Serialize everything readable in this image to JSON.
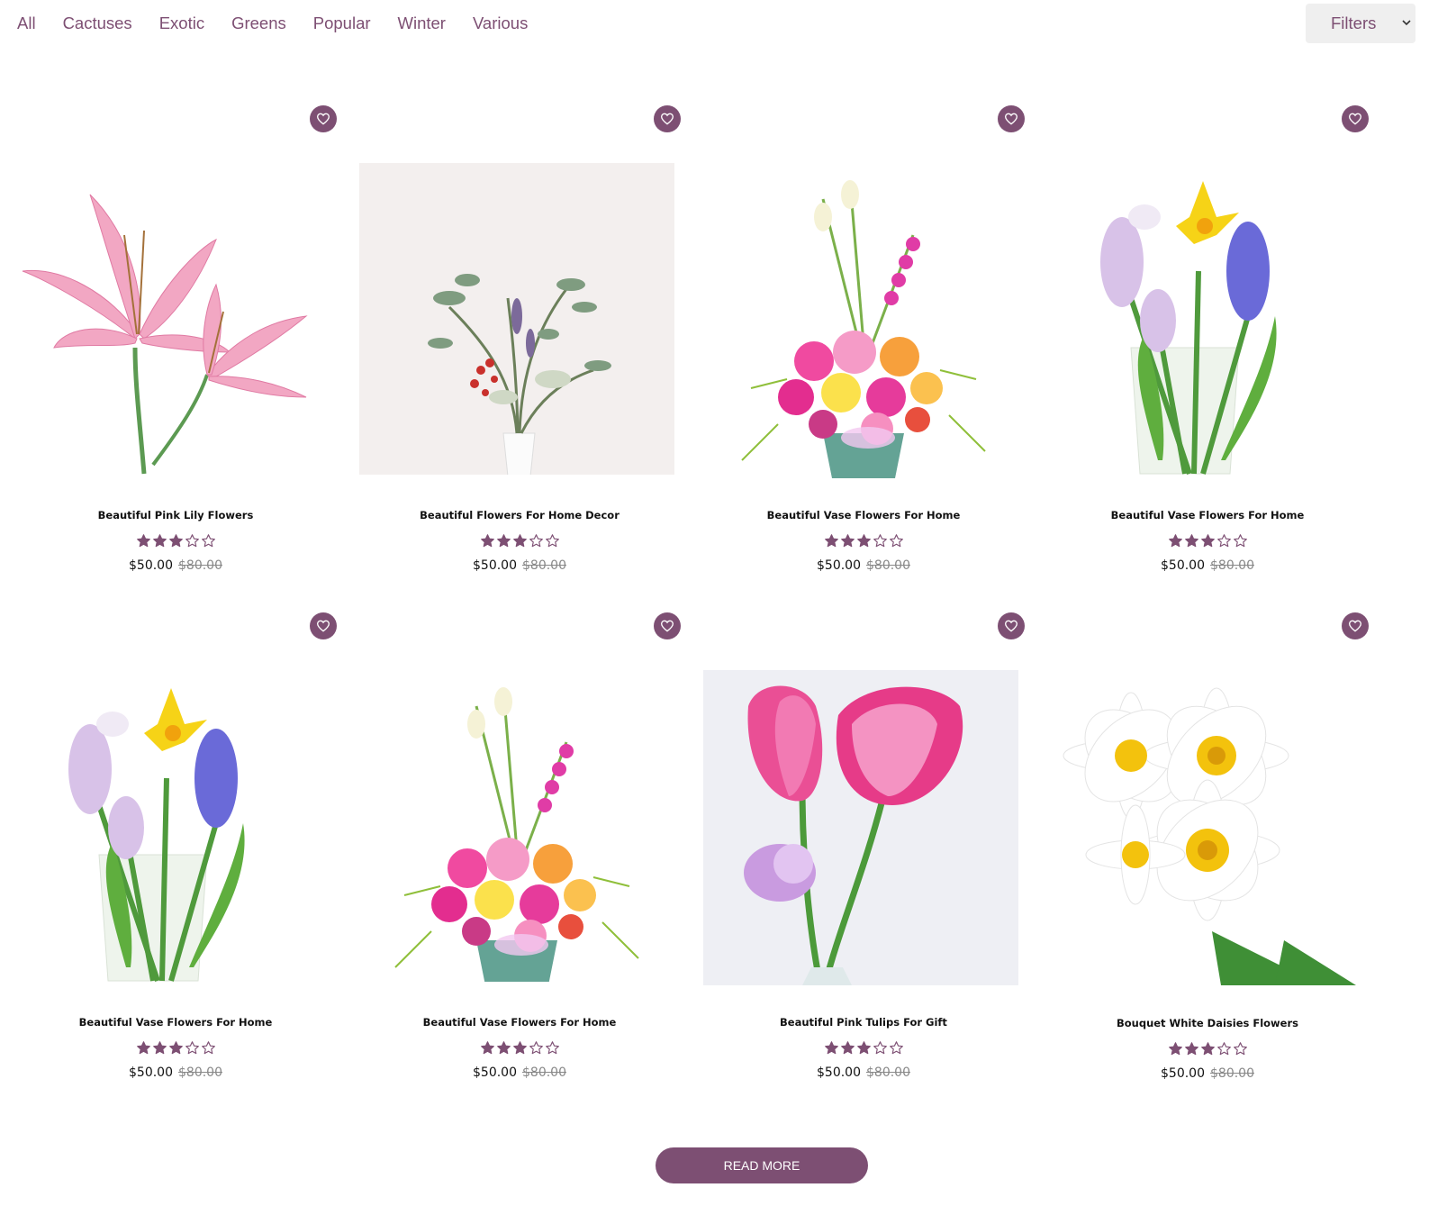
{
  "categories": [
    "All",
    "Cactuses",
    "Exotic",
    "Greens",
    "Popular",
    "Winter",
    "Various"
  ],
  "filters": {
    "label": "Filters"
  },
  "products": [
    {
      "title": "Beautiful Pink Lily Flowers",
      "rating": 3,
      "rating_max": 5,
      "price": "$50.00",
      "old_price": "$80.00",
      "image": "pink-lily"
    },
    {
      "title": "Beautiful Flowers For Home Decor",
      "rating": 3,
      "rating_max": 5,
      "price": "$50.00",
      "old_price": "$80.00",
      "image": "dried-bouquet"
    },
    {
      "title": "Beautiful Vase Flowers For Home",
      "rating": 3,
      "rating_max": 5,
      "price": "$50.00",
      "old_price": "$80.00",
      "image": "mixed-bouquet"
    },
    {
      "title": "Beautiful Vase Flowers For Home",
      "rating": 3,
      "rating_max": 5,
      "price": "$50.00",
      "old_price": "$80.00",
      "image": "hyacinth-vase"
    },
    {
      "title": "Beautiful Vase Flowers For Home",
      "rating": 3,
      "rating_max": 5,
      "price": "$50.00",
      "old_price": "$80.00",
      "image": "hyacinth-vase"
    },
    {
      "title": "Beautiful Vase Flowers For Home",
      "rating": 3,
      "rating_max": 5,
      "price": "$50.00",
      "old_price": "$80.00",
      "image": "mixed-bouquet"
    },
    {
      "title": "Beautiful Pink Tulips For Gift",
      "rating": 3,
      "rating_max": 5,
      "price": "$50.00",
      "old_price": "$80.00",
      "image": "pink-tulips"
    },
    {
      "title": "Bouquet White Daisies Flowers",
      "rating": 3,
      "rating_max": 5,
      "price": "$50.00",
      "old_price": "$80.00",
      "image": "white-daisies"
    }
  ],
  "read_more": "READ MORE",
  "colors": {
    "accent": "#7d4f73",
    "star": "#7d4f73",
    "old_price": "#888888"
  },
  "icons": {
    "wishlist": "heart-icon",
    "rating": "star-icon",
    "filter_dropdown": "chevron-down-icon"
  }
}
